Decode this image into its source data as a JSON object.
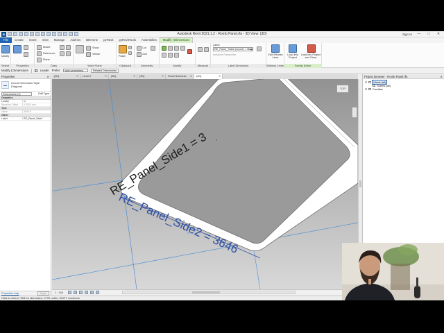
{
  "titlebar": {
    "window_title": "Autodesk Revit 2021.1.2 - Romb Panel.rfa - 3D View: {3D}",
    "sign_in": "Sign In",
    "logo": "R"
  },
  "ribbon_tabs": [
    "File",
    "Create",
    "Insert",
    "View",
    "Manage",
    "Add-Ins",
    "BIM One",
    "pyRevit",
    "pyRevitTools",
    "Assemblies",
    "Modify | Dimensions"
  ],
  "ribbon": {
    "modify_label": "Modify",
    "select_panel": "Select",
    "properties_panel": "Properties",
    "draw_panel": "Draw",
    "workplane_panel": "Work Plane",
    "workplane_items": [
      "Show",
      "Viewer"
    ],
    "clipboard_panel": "Clipboard",
    "clipboard_paste": "Paste",
    "geometry_panel": "Geometry",
    "geometry_items": [
      "Cut",
      "Join"
    ],
    "modify_panel": "Modify",
    "measure_panel": "Measure",
    "label_panel": "Label Dimension",
    "label_title": "Label:",
    "label_value": "RE_Panel_Side2 (report) = 3646",
    "instance_param": "Instance Parameter",
    "witness_panel": "Witness Lines",
    "edit_witness": "Edit Witness Lines",
    "family_panel": "Family Editor",
    "load_project": "Load into Project",
    "load_close": "Load into Project and Close",
    "model_items": [
      "Model",
      "Reference",
      "Plane"
    ]
  },
  "options_bar": {
    "title": "Modify | Dimensions",
    "leader_label": "Leader",
    "prefer_label": "Prefer:",
    "prefer_value": "Wall centerlines",
    "related_button": "Related Dimensions"
  },
  "properties": {
    "header": "Properties",
    "type_name_1": "Linear Dimension Style",
    "type_name_2": "Diagonal",
    "selector": "Dimensions (1)",
    "edit_type": "Edit Type",
    "groups": [
      {
        "name": "Graphics",
        "rows": [
          {
            "k": "Leader",
            "v": "☑",
            "dim": false
          },
          {
            "k": "Baseline Offset",
            "v": "0.0000 mm",
            "dim": true
          }
        ]
      },
      {
        "name": "Text",
        "rows": [
          {
            "k": "Value",
            "v": "3645.6",
            "dim": true
          }
        ]
      },
      {
        "name": "Other",
        "rows": [
          {
            "k": "Label",
            "v": "RE_Panel_Side2",
            "dim": false
          }
        ]
      }
    ],
    "help_link": "Properties help",
    "apply": "Apply"
  },
  "view_tabs": [
    {
      "label": "{3D}"
    },
    {
      "label": "Level 0"
    },
    {
      "label": "{3D}"
    },
    {
      "label": "{3D}"
    },
    {
      "label": "Panel Schedule"
    },
    {
      "label": "{3D}"
    }
  ],
  "canvas": {
    "dim1": "RE_Panel_Side1 = 3",
    "dim2": "RE_Panel_Side2 = 3646",
    "viewcube": "TOP"
  },
  "viewbar": {
    "scale": "1 : 100"
  },
  "browser": {
    "header": "Project Browser - Romb Panel.rfa",
    "nodes": [
      {
        "label": "Views (all)",
        "toggle": "⊟",
        "selected": true,
        "child": false
      },
      {
        "label": "Sheets (all)",
        "toggle": "",
        "selected": false,
        "child": true
      },
      {
        "label": "Families",
        "toggle": "⊞",
        "selected": false,
        "child": false
      }
    ]
  },
  "statusbar": {
    "text": "Click to select, TAB for alternates, CTRL adds, SHIFT unselects."
  },
  "colors": {
    "file_tab": "#1f65b4",
    "context_tab": "#d9efc9",
    "dimension_text": "#2d4fa3",
    "reference_line": "#4d8fd6"
  }
}
